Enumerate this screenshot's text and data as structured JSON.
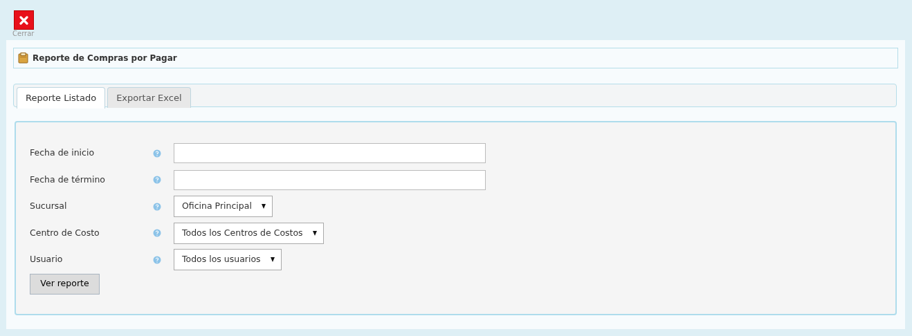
{
  "toolbar": {
    "close_label": "Cerrar"
  },
  "header": {
    "title": "Reporte de Compras por Pagar"
  },
  "tabs": [
    {
      "label": "Reporte Listado",
      "selected": true
    },
    {
      "label": "Exportar Excel",
      "selected": false
    }
  ],
  "form": {
    "fields": [
      {
        "label": "Fecha de inicio",
        "kind": "text"
      },
      {
        "label": "Fecha de término",
        "kind": "text"
      },
      {
        "label": "Sucursal",
        "kind": "select",
        "value": "Oficina Principal"
      },
      {
        "label": "Centro de Costo",
        "kind": "select",
        "value": "Todos los Centros de Costos"
      },
      {
        "label": "Usuario",
        "kind": "select",
        "value": "Todos los usuarios"
      }
    ],
    "submit": "Ver reporte"
  }
}
